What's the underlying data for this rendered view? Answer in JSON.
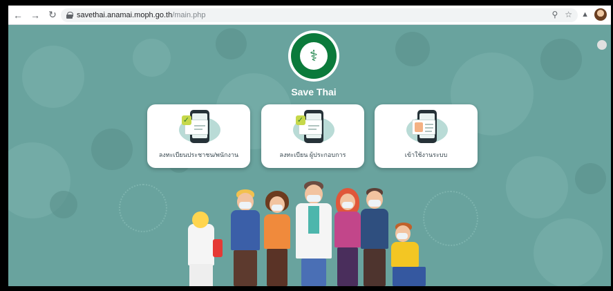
{
  "browser": {
    "url_host": "savethai.anamai.moph.go.th",
    "url_path": "/main.php",
    "back_icon": "arrow-left-icon",
    "forward_icon": "arrow-right-icon",
    "reload_icon": "reload-icon"
  },
  "site": {
    "title": "Save Thai",
    "logo_alt": "Ministry of Public Health seal"
  },
  "cards": [
    {
      "label": "ลงทะเบียนประชาชน/พนักงาน",
      "icon": "phone-checklist-icon"
    },
    {
      "label": "ลงทะเบียน ผู้ประกอบการ",
      "icon": "phone-checklist-icon"
    },
    {
      "label": "เข้าใช้งานระบบ",
      "icon": "phone-id-card-icon"
    }
  ],
  "colors": {
    "background": "#69a39e",
    "logo_green": "#0b7a3b",
    "card": "#ffffff"
  }
}
